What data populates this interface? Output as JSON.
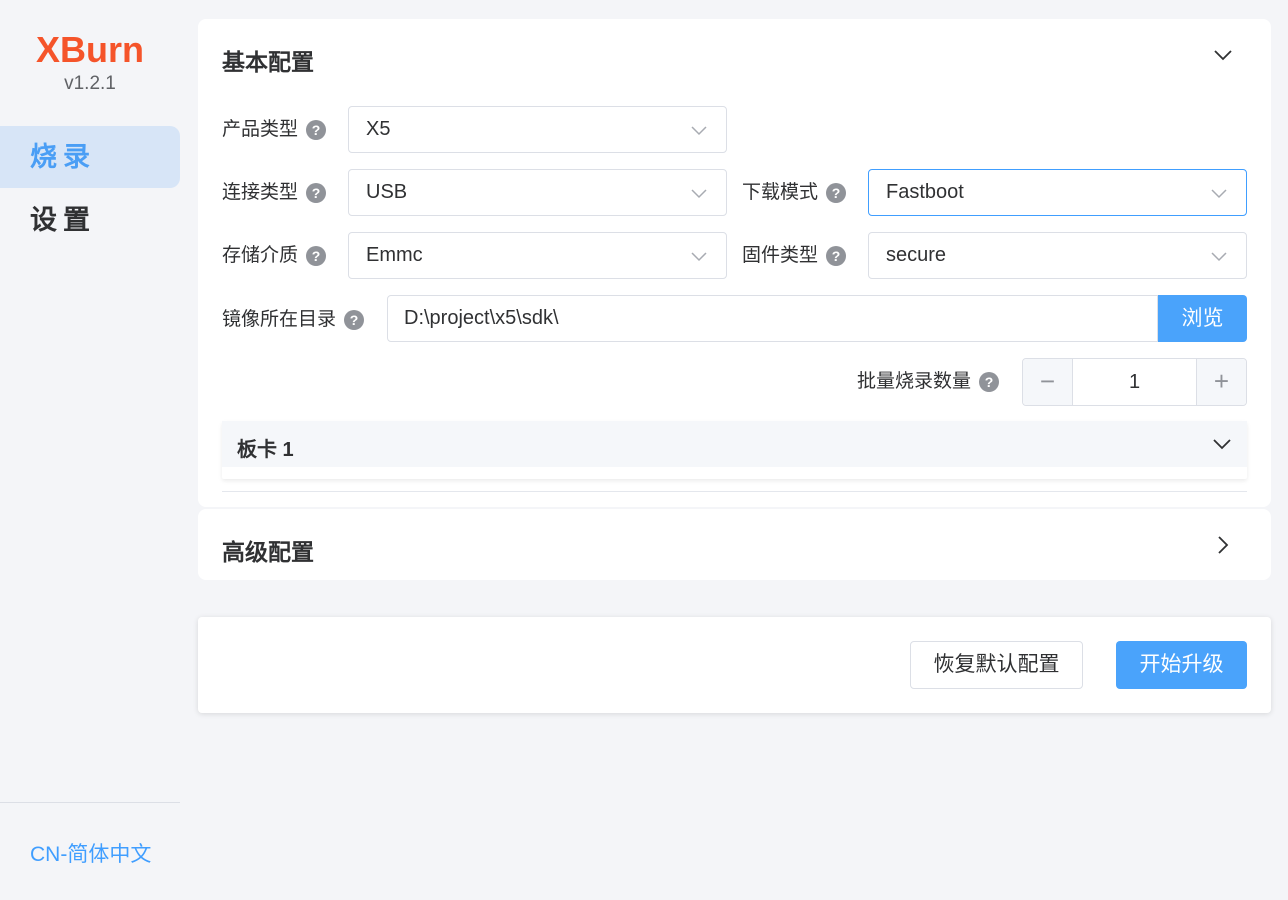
{
  "sidebar": {
    "brand": "XBurn",
    "version": "v1.2.1",
    "items": [
      {
        "label": "烧录",
        "active": true
      },
      {
        "label": "设置",
        "active": false
      }
    ],
    "language": "CN-简体中文"
  },
  "basic": {
    "title": "基本配置",
    "product_type": {
      "label": "产品类型",
      "value": "X5"
    },
    "connection_type": {
      "label": "连接类型",
      "value": "USB"
    },
    "download_mode": {
      "label": "下载模式",
      "value": "Fastboot"
    },
    "storage_medium": {
      "label": "存储介质",
      "value": "Emmc"
    },
    "firmware_type": {
      "label": "固件类型",
      "value": "secure"
    },
    "image_dir": {
      "label": "镜像所在目录",
      "value": "D:\\project\\x5\\sdk\\",
      "browse_label": "浏览"
    },
    "batch_count": {
      "label": "批量烧录数量",
      "value": "1",
      "minus": "−",
      "plus": "+"
    },
    "board": {
      "title": "板卡 1"
    }
  },
  "advanced": {
    "title": "高级配置"
  },
  "actions": {
    "reset_label": "恢复默认配置",
    "start_label": "开始升级"
  },
  "icons": {
    "help": "?",
    "chevron_down": "chevron-down-icon",
    "chevron_right": "chevron-right-icon"
  },
  "colors": {
    "brand": "#f5542a",
    "accent": "#409eff",
    "active_bg": "#d7e5f7"
  }
}
